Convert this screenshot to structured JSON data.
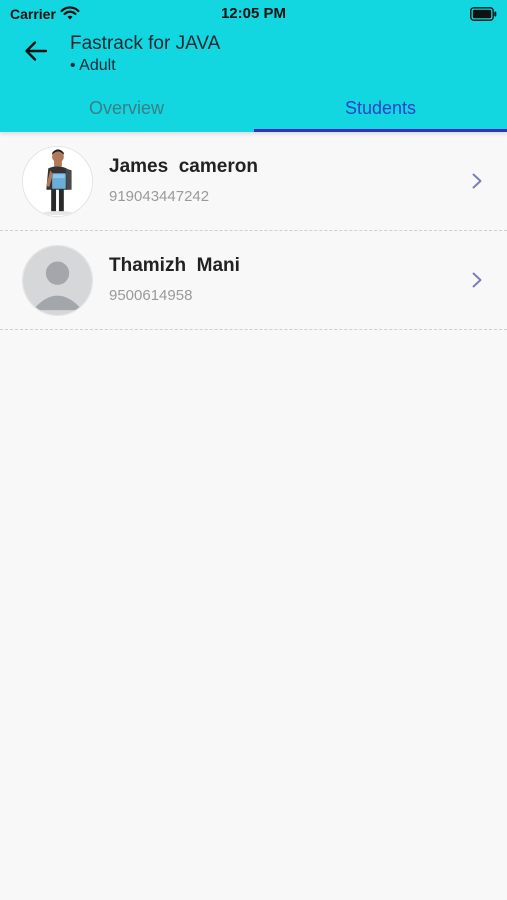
{
  "status_bar": {
    "carrier": "Carrier",
    "time": "12:05 PM"
  },
  "header": {
    "title": "Fastrack for JAVA",
    "subtitle": "• Adult"
  },
  "tabs": [
    {
      "label": "Overview",
      "active": false
    },
    {
      "label": "Students",
      "active": true
    }
  ],
  "students": [
    {
      "name": "James  cameron",
      "phone": "919043447242",
      "avatar": "photo"
    },
    {
      "name": "Thamizh  Mani",
      "phone": "9500614958",
      "avatar": "placeholder"
    }
  ],
  "colors": {
    "header_bg": "#12d6e0",
    "active_tab": "#2a44c8",
    "inactive_tab": "#3a7f86",
    "indicator": "#3a2fb8",
    "chevron": "#7a7fb8"
  },
  "icons": [
    "wifi-icon",
    "battery-icon",
    "back-arrow-icon",
    "chevron-right-icon",
    "avatar-placeholder-icon"
  ]
}
